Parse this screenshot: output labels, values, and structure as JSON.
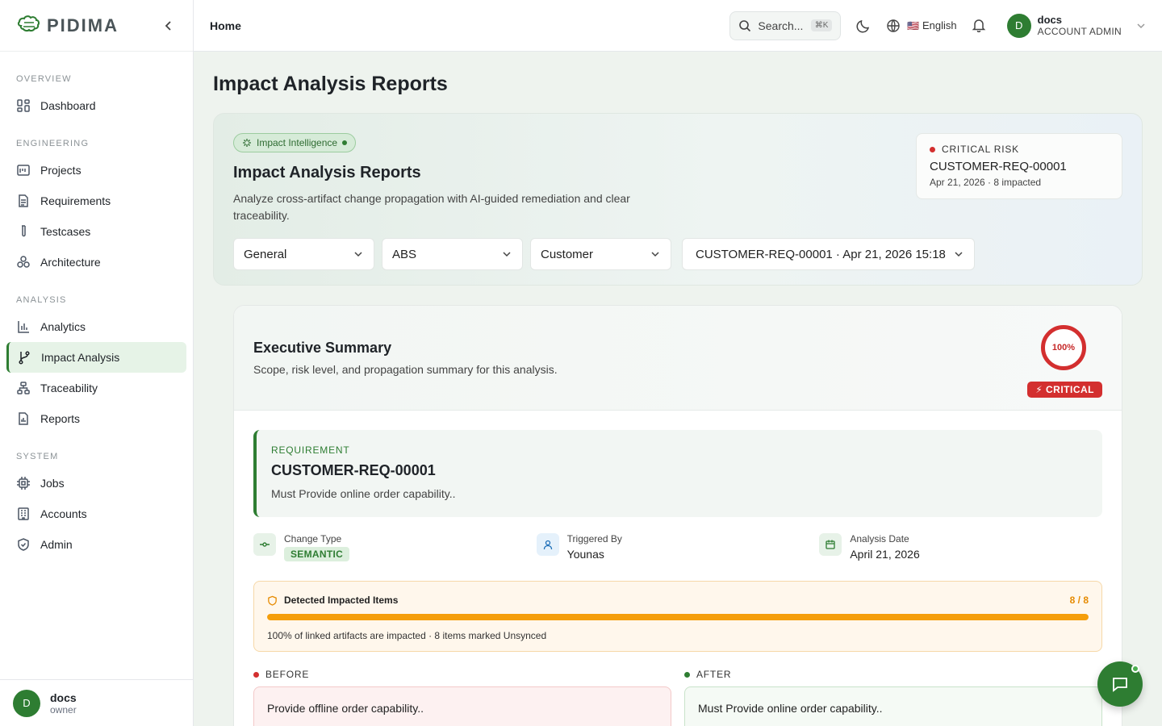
{
  "app": {
    "logo_text": "PIDIMA"
  },
  "sidebar": {
    "sections": [
      {
        "title": "OVERVIEW",
        "items": [
          {
            "label": "Dashboard",
            "icon": "dashboard-icon"
          }
        ]
      },
      {
        "title": "ENGINEERING",
        "items": [
          {
            "label": "Projects",
            "icon": "projects-icon"
          },
          {
            "label": "Requirements",
            "icon": "requirements-icon"
          },
          {
            "label": "Testcases",
            "icon": "testcases-icon"
          },
          {
            "label": "Architecture",
            "icon": "architecture-icon"
          }
        ]
      },
      {
        "title": "ANALYSIS",
        "items": [
          {
            "label": "Analytics",
            "icon": "analytics-icon"
          },
          {
            "label": "Impact Analysis",
            "icon": "impact-icon",
            "active": true
          },
          {
            "label": "Traceability",
            "icon": "traceability-icon"
          },
          {
            "label": "Reports",
            "icon": "reports-icon"
          }
        ]
      },
      {
        "title": "SYSTEM",
        "items": [
          {
            "label": "Jobs",
            "icon": "jobs-icon"
          },
          {
            "label": "Accounts",
            "icon": "accounts-icon"
          },
          {
            "label": "Admin",
            "icon": "admin-icon"
          }
        ]
      }
    ],
    "user": {
      "initial": "D",
      "name": "docs",
      "role": "owner"
    }
  },
  "topbar": {
    "breadcrumb": "Home",
    "search_placeholder": "Search...",
    "search_shortcut": "⌘K",
    "language_flag": "🇺🇸",
    "language": "English",
    "account": {
      "initial": "D",
      "name": "docs",
      "role": "ACCOUNT ADMIN"
    }
  },
  "page": {
    "title": "Impact Analysis Reports"
  },
  "hero": {
    "badge": "Impact Intelligence",
    "title": "Impact Analysis Reports",
    "description": "Analyze cross-artifact change propagation with AI-guided remediation and clear traceability.",
    "risk": {
      "label": "CRITICAL RISK",
      "id": "CUSTOMER-REQ-00001",
      "meta": "Apr 21, 2026 · 8 impacted"
    },
    "selects": {
      "project": "General",
      "system": "ABS",
      "category": "Customer",
      "report": "CUSTOMER-REQ-00001 · Apr 21, 2026 15:18"
    }
  },
  "summary": {
    "title": "Executive Summary",
    "subtitle": "Scope, risk level, and propagation summary for this analysis.",
    "score": "100%",
    "score_fraction": 1.0,
    "level": "⚡ CRITICAL",
    "requirement": {
      "label": "REQUIREMENT",
      "id": "CUSTOMER-REQ-00001",
      "description": "Must Provide online order capability.."
    },
    "meta": {
      "change_type_label": "Change Type",
      "change_type": "SEMANTIC",
      "triggered_by_label": "Triggered By",
      "triggered_by": "Younas",
      "date_label": "Analysis Date",
      "date": "April 21, 2026"
    },
    "detected": {
      "title": "Detected Impacted Items",
      "count": "8 / 8",
      "progress": 1.0,
      "note": "100% of linked artifacts are impacted · 8 items marked Unsynced"
    },
    "before": {
      "label": "BEFORE",
      "text": "Provide offline order capability.."
    },
    "after": {
      "label": "AFTER",
      "text": "Must Provide online order capability.."
    }
  },
  "colors": {
    "brand": "#2e7d32",
    "critical": "#d32f2f",
    "warning": "#f59e0b"
  }
}
